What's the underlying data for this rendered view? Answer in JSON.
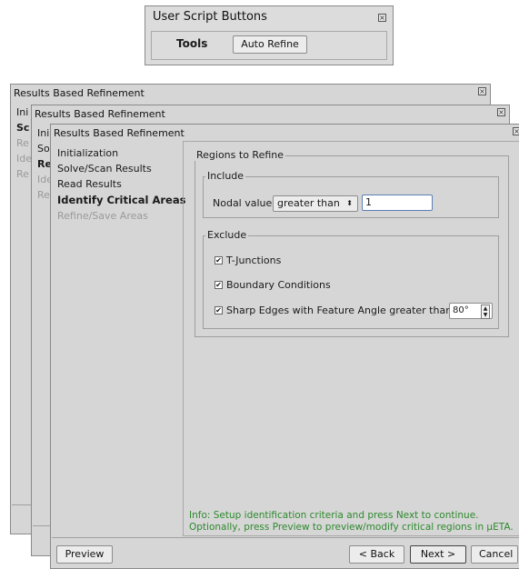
{
  "user_script_window": {
    "title": "User Script Buttons",
    "tools_label": "Tools",
    "auto_refine_label": "Auto Refine"
  },
  "dialog_title": "Results Based Refinement",
  "bg_nav": {
    "window1": [
      "Ini",
      "Sc",
      "Re",
      "Ide",
      "Re"
    ],
    "window2": [
      "Ini",
      "So",
      "Re",
      "Ide",
      "Re"
    ]
  },
  "nav": {
    "items": [
      "Initialization",
      "Solve/Scan Results",
      "Read Results",
      "Identify Critical Areas",
      "Refine/Save Areas"
    ]
  },
  "regions": {
    "title": "Regions to Refine",
    "include": {
      "title": "Include",
      "nodal_label": "Nodal value:",
      "condition": "greater than",
      "value": "1"
    },
    "exclude": {
      "title": "Exclude",
      "t_junctions": "T-Junctions",
      "boundary": "Boundary Conditions",
      "sharp_edges": "Sharp Edges with Feature Angle greater than:",
      "angle": "80°"
    }
  },
  "info": {
    "line1": "Info: Setup identification criteria and press Next to continue.",
    "line2": "Optionally, press Preview to preview/modify critical regions in µETA."
  },
  "buttons": {
    "preview": "Preview",
    "back": "< Back",
    "next": "Next >",
    "cancel": "Cancel"
  },
  "colors": {
    "info_text": "#2d8a2d",
    "window_bg": "#d6d6d6"
  }
}
